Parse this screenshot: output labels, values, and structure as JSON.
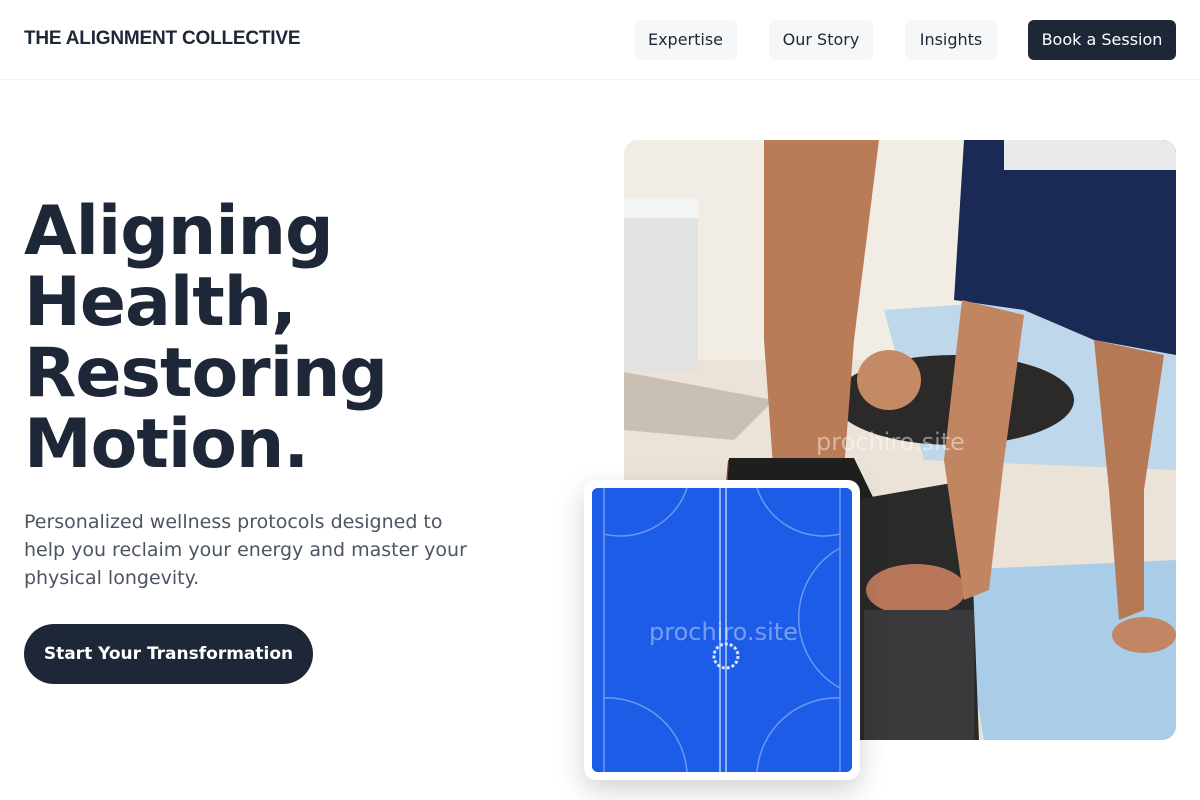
{
  "header": {
    "brand": "THE ALIGNMENT COLLECTIVE",
    "nav": [
      {
        "label": "Expertise"
      },
      {
        "label": "Our Story"
      },
      {
        "label": "Insights"
      }
    ],
    "cta_label": "Book a Session"
  },
  "hero": {
    "headline_lines": [
      "Aligning",
      "Health,",
      "Restoring",
      "Motion."
    ],
    "subtext": "Personalized wellness protocols designed to help you reclaim your energy and master your physical longevity.",
    "cta_label": "Start Your Transformation"
  },
  "media": {
    "watermark_main": "prochiro.site",
    "watermark_card": "prochiro.site"
  },
  "colors": {
    "primary": "#1e2738",
    "nav_bg": "#f5f7f9",
    "body_text": "#4b5563",
    "field_blue": "#1a5de0"
  }
}
